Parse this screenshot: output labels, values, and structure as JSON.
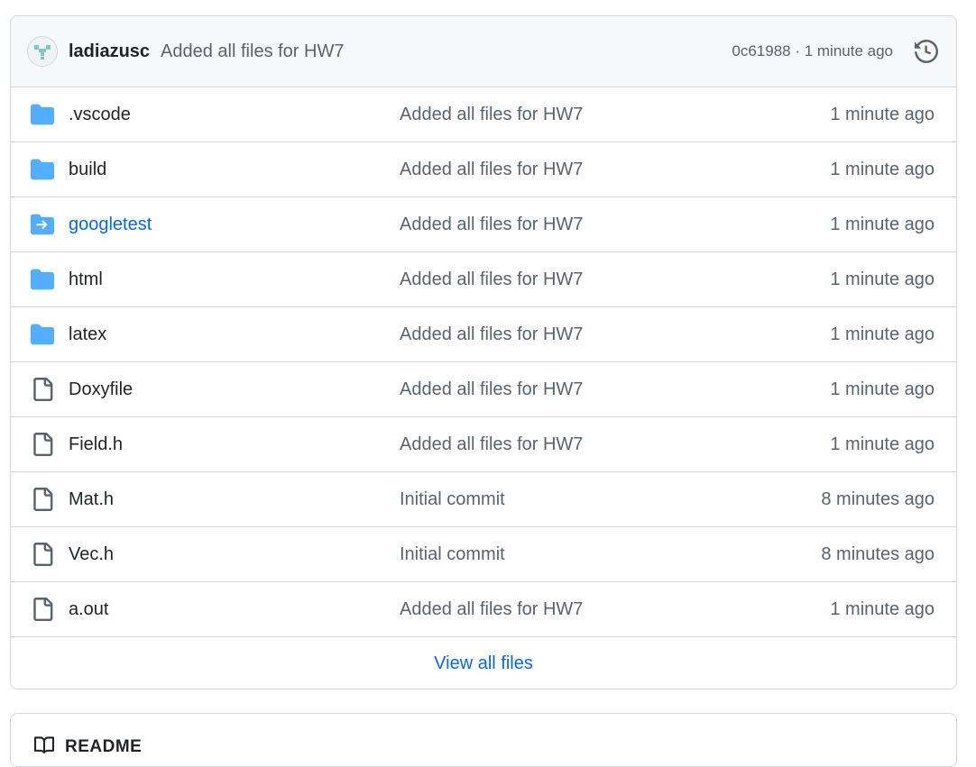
{
  "commit": {
    "author": "ladiazusc",
    "message": "Added all files for HW7",
    "meta": "0c61988 · 1 minute ago"
  },
  "files": [
    {
      "name": ".vscode",
      "type": "folder",
      "message": "Added all files for HW7",
      "age": "1 minute ago"
    },
    {
      "name": "build",
      "type": "folder",
      "message": "Added all files for HW7",
      "age": "1 minute ago"
    },
    {
      "name": "googletest",
      "type": "submodule",
      "message": "Added all files for HW7",
      "age": "1 minute ago"
    },
    {
      "name": "html",
      "type": "folder",
      "message": "Added all files for HW7",
      "age": "1 minute ago"
    },
    {
      "name": "latex",
      "type": "folder",
      "message": "Added all files for HW7",
      "age": "1 minute ago"
    },
    {
      "name": "Doxyfile",
      "type": "file",
      "message": "Added all files for HW7",
      "age": "1 minute ago"
    },
    {
      "name": "Field.h",
      "type": "file",
      "message": "Added all files for HW7",
      "age": "1 minute ago"
    },
    {
      "name": "Mat.h",
      "type": "file",
      "message": "Initial commit",
      "age": "8 minutes ago"
    },
    {
      "name": "Vec.h",
      "type": "file",
      "message": "Initial commit",
      "age": "8 minutes ago"
    },
    {
      "name": "a.out",
      "type": "file",
      "message": "Added all files for HW7",
      "age": "1 minute ago"
    }
  ],
  "view_all_label": "View all files",
  "readme": {
    "label": "README"
  },
  "colors": {
    "folder": "#54aeff",
    "link": "#0969da",
    "muted": "#59636e",
    "border": "#d0d7de"
  },
  "icons": {
    "folder": "folder-icon",
    "submodule": "submodule-folder-icon",
    "file": "file-icon",
    "history": "history-icon",
    "readme": "book-icon"
  }
}
